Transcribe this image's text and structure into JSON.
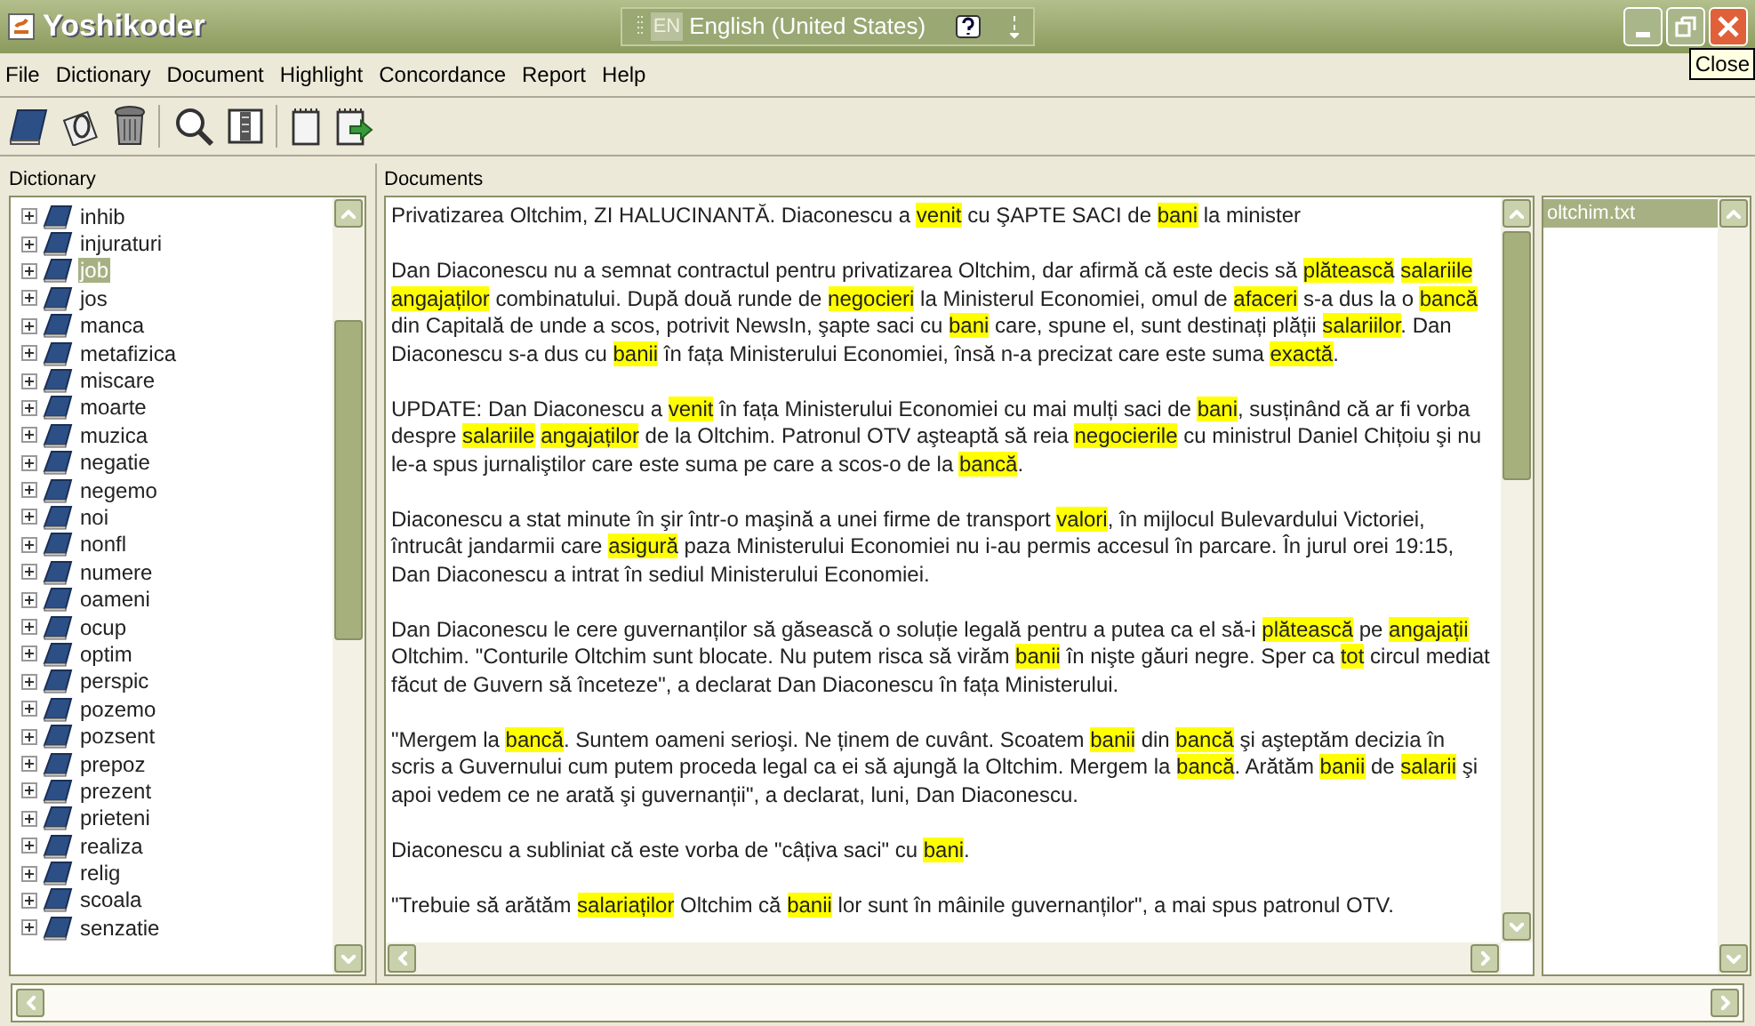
{
  "window": {
    "title": "Yoshikoder",
    "tooltip": "Close"
  },
  "language_bar": {
    "code": "EN",
    "language": "English (United States)"
  },
  "menu": [
    "File",
    "Dictionary",
    "Document",
    "Highlight",
    "Concordance",
    "Report",
    "Help"
  ],
  "dictionary": {
    "title": "Dictionary",
    "items": [
      {
        "label": "inhib",
        "expanded": false,
        "selected": false
      },
      {
        "label": "injuraturi",
        "expanded": false,
        "selected": false
      },
      {
        "label": "job",
        "expanded": false,
        "selected": true
      },
      {
        "label": "jos",
        "expanded": false,
        "selected": false
      },
      {
        "label": "manca",
        "expanded": false,
        "selected": false
      },
      {
        "label": "metafizica",
        "expanded": false,
        "selected": false
      },
      {
        "label": "miscare",
        "expanded": false,
        "selected": false
      },
      {
        "label": "moarte",
        "expanded": false,
        "selected": false
      },
      {
        "label": "muzica",
        "expanded": false,
        "selected": false
      },
      {
        "label": "negatie",
        "expanded": false,
        "selected": false
      },
      {
        "label": "negemo",
        "expanded": false,
        "selected": false
      },
      {
        "label": "noi",
        "expanded": false,
        "selected": false
      },
      {
        "label": "nonfl",
        "expanded": false,
        "selected": false
      },
      {
        "label": "numere",
        "expanded": false,
        "selected": false
      },
      {
        "label": "oameni",
        "expanded": false,
        "selected": false
      },
      {
        "label": "ocup",
        "expanded": false,
        "selected": false
      },
      {
        "label": "optim",
        "expanded": false,
        "selected": false
      },
      {
        "label": "perspic",
        "expanded": false,
        "selected": false
      },
      {
        "label": "pozemo",
        "expanded": false,
        "selected": false
      },
      {
        "label": "pozsent",
        "expanded": false,
        "selected": false
      },
      {
        "label": "prepoz",
        "expanded": false,
        "selected": false
      },
      {
        "label": "prezent",
        "expanded": false,
        "selected": false
      },
      {
        "label": "prieteni",
        "expanded": false,
        "selected": false
      },
      {
        "label": "realiza",
        "expanded": false,
        "selected": false
      },
      {
        "label": "relig",
        "expanded": false,
        "selected": false
      },
      {
        "label": "scoala",
        "expanded": false,
        "selected": false
      },
      {
        "label": "senzatie",
        "expanded": false,
        "selected": false
      }
    ]
  },
  "documents": {
    "title": "Documents",
    "files": [
      {
        "label": "oltchim.txt",
        "selected": true
      }
    ],
    "paragraphs": [
      [
        {
          "text": "Privatizarea Oltchim, ZI HALUCINANTĂ. Diaconescu a ",
          "highlighted": false
        },
        {
          "text": "venit",
          "highlighted": true
        },
        {
          "text": " cu ŞAPTE SACI de ",
          "highlighted": false
        },
        {
          "text": "bani",
          "highlighted": true
        },
        {
          "text": " la minister",
          "highlighted": false
        }
      ],
      [
        {
          "text": "Dan Diaconescu nu a semnat contractul pentru privatizarea Oltchim, dar afirmă că este decis să ",
          "highlighted": false
        },
        {
          "text": "plătească ",
          "highlighted": true
        },
        {
          "text": "salariile ",
          "highlighted": true
        },
        {
          "text": "angajaților",
          "highlighted": true
        },
        {
          "text": " combinatului. După două runde de ",
          "highlighted": false
        },
        {
          "text": "negocieri",
          "highlighted": true
        },
        {
          "text": " la Ministerul Economiei, omul de ",
          "highlighted": false
        },
        {
          "text": "afaceri",
          "highlighted": true
        },
        {
          "text": " s-a dus la o ",
          "highlighted": false
        },
        {
          "text": "bancă",
          "highlighted": true
        },
        {
          "text": " din Capitală de unde a scos, potrivit NewsIn, şapte saci cu ",
          "highlighted": false
        },
        {
          "text": "bani",
          "highlighted": true
        },
        {
          "text": " care, spune el, sunt destinați plății ",
          "highlighted": false
        },
        {
          "text": "salariilor",
          "highlighted": true
        },
        {
          "text": ". Dan Diaconescu s-a dus cu ",
          "highlighted": false
        },
        {
          "text": "banii",
          "highlighted": true
        },
        {
          "text": " în fața Ministerului Economiei, însă n-a precizat care este suma ",
          "highlighted": false
        },
        {
          "text": "exactă",
          "highlighted": true
        },
        {
          "text": ".",
          "highlighted": false
        }
      ],
      [
        {
          "text": "UPDATE: Dan Diaconescu a ",
          "highlighted": false
        },
        {
          "text": "venit",
          "highlighted": true
        },
        {
          "text": " în fața Ministerului Economiei cu mai mulți saci de ",
          "highlighted": false
        },
        {
          "text": "bani",
          "highlighted": true
        },
        {
          "text": ", susținând că ar fi vorba despre ",
          "highlighted": false
        },
        {
          "text": "salariile ",
          "highlighted": true
        },
        {
          "text": "angajaților",
          "highlighted": true
        },
        {
          "text": " de la Oltchim. Patronul OTV aşteaptă să reia ",
          "highlighted": false
        },
        {
          "text": "negocierile",
          "highlighted": true
        },
        {
          "text": " cu ministrul Daniel Chițoiu şi nu le-a spus jurnaliştilor care este suma pe care a scos-o de la ",
          "highlighted": false
        },
        {
          "text": "bancă",
          "highlighted": true
        },
        {
          "text": ".",
          "highlighted": false
        }
      ],
      [
        {
          "text": "Diaconescu a stat minute în şir într-o maşină a unei firme de transport ",
          "highlighted": false
        },
        {
          "text": "valori",
          "highlighted": true
        },
        {
          "text": ", în mijlocul Bulevardului Victoriei, întrucât jandarmii care ",
          "highlighted": false
        },
        {
          "text": "asigură",
          "highlighted": true
        },
        {
          "text": " paza Ministerului Economiei nu i-au permis accesul în parcare. În jurul orei 19:15, Dan Diaconescu a intrat în sediul Ministerului Economiei.",
          "highlighted": false
        }
      ],
      [
        {
          "text": "Dan Diaconescu le cere guvernanților să găsească o soluție legală pentru a putea ca el să-i ",
          "highlighted": false
        },
        {
          "text": "plătească",
          "highlighted": true
        },
        {
          "text": " pe ",
          "highlighted": false
        },
        {
          "text": "angajații",
          "highlighted": true
        },
        {
          "text": " Oltchim. \"Conturile Oltchim sunt blocate. Nu putem risca să virăm ",
          "highlighted": false
        },
        {
          "text": "banii",
          "highlighted": true
        },
        {
          "text": " în nişte găuri negre. Sper ca ",
          "highlighted": false
        },
        {
          "text": "tot",
          "highlighted": true
        },
        {
          "text": " circul mediat făcut de Guvern să înceteze\", a declarat Dan Diaconescu în fața Ministerului.",
          "highlighted": false
        }
      ],
      [
        {
          "text": "\"Mergem la ",
          "highlighted": false
        },
        {
          "text": "bancă",
          "highlighted": true
        },
        {
          "text": ". Suntem oameni serioşi. Ne ținem de cuvânt. Scoatem ",
          "highlighted": false
        },
        {
          "text": "banii",
          "highlighted": true
        },
        {
          "text": " din ",
          "highlighted": false
        },
        {
          "text": "bancă",
          "highlighted": true
        },
        {
          "text": " şi aşteptăm decizia în scris a Guvernului cum putem proceda legal ca ei să ajungă la Oltchim. Mergem la ",
          "highlighted": false
        },
        {
          "text": "bancă",
          "highlighted": true
        },
        {
          "text": ". Arătăm ",
          "highlighted": false
        },
        {
          "text": "banii",
          "highlighted": true
        },
        {
          "text": " de ",
          "highlighted": false
        },
        {
          "text": "salarii",
          "highlighted": true
        },
        {
          "text": " şi apoi vedem ce ne arată şi guvernanții\", a declarat, luni, Dan Diaconescu.",
          "highlighted": false
        }
      ],
      [
        {
          "text": "Diaconescu a subliniat că este vorba de \"câțiva saci\" cu ",
          "highlighted": false
        },
        {
          "text": "bani",
          "highlighted": true
        },
        {
          "text": ".",
          "highlighted": false
        }
      ],
      [
        {
          "text": "\"Trebuie să arătăm ",
          "highlighted": false
        },
        {
          "text": "salariaților",
          "highlighted": true
        },
        {
          "text": " Oltchim că ",
          "highlighted": false
        },
        {
          "text": "banii",
          "highlighted": true
        },
        {
          "text": " lor sunt în mâinile guvernanților\", a mai spus patronul OTV.",
          "highlighted": false
        }
      ]
    ]
  }
}
